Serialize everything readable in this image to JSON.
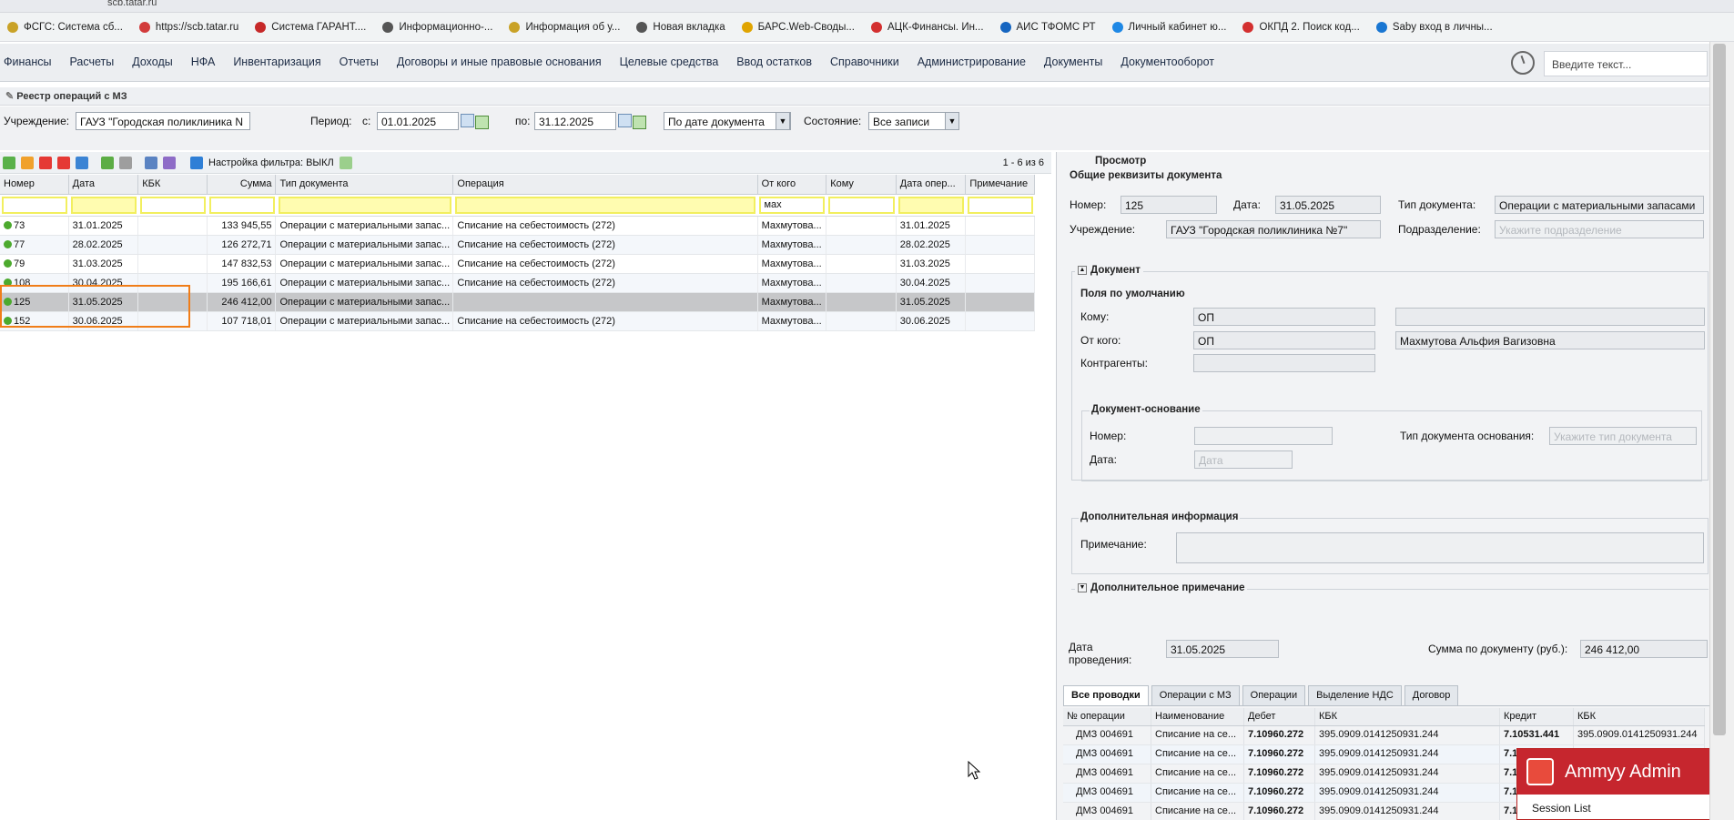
{
  "browser": {
    "url": "scb.tatar.ru",
    "bookmarks": [
      {
        "label": "ФСГС: Система сб...",
        "icon": "fsgs-icon",
        "color": "#c9a227"
      },
      {
        "label": "https://scb.tatar.ru",
        "icon": "cloud-icon",
        "color": "#d23b3b"
      },
      {
        "label": "Система ГАРАНТ....",
        "icon": "garant-icon",
        "color": "#c62828"
      },
      {
        "label": "Информационно-...",
        "icon": "globe-icon",
        "color": "#555555"
      },
      {
        "label": "Информация об у...",
        "icon": "emblem-icon",
        "color": "#c9a227"
      },
      {
        "label": "Новая вкладка",
        "icon": "globe-icon",
        "color": "#555555"
      },
      {
        "label": "БАРС.Web-Своды...",
        "icon": "bars-icon",
        "color": "#e0a400"
      },
      {
        "label": "АЦК-Финансы. Ин...",
        "icon": "ack-icon",
        "color": "#d32f2f"
      },
      {
        "label": "АИС ТФОМС РТ",
        "icon": "tfoms-icon",
        "color": "#1565c0"
      },
      {
        "label": "Личный кабинет ю...",
        "icon": "cabinet-icon",
        "color": "#1e88e5"
      },
      {
        "label": "ОКПД 2. Поиск код...",
        "icon": "okpd-icon",
        "color": "#d32f2f"
      },
      {
        "label": "Saby вход в личны...",
        "icon": "saby-icon",
        "color": "#1976d2"
      }
    ]
  },
  "menu": {
    "items": [
      "Финансы",
      "Расчеты",
      "Доходы",
      "НФА",
      "Инвентаризация",
      "Отчеты",
      "Договоры и иные правовые основания",
      "Целевые средства",
      "Ввод остатков",
      "Справочники",
      "Администрирование",
      "Документы",
      "Документооборот"
    ],
    "search_placeholder": "Введите текст..."
  },
  "page": {
    "title": "Реестр операций с МЗ"
  },
  "filters": {
    "institution_label": "Учреждение:",
    "institution_value": "ГАУЗ \"Городская поликлиника N",
    "period_label": "Период:",
    "from_label": "с:",
    "from_value": "01.01.2025",
    "to_label": "по:",
    "to_value": "31.12.2025",
    "date_mode_value": "По дате документа",
    "state_label": "Состояние:",
    "state_value": "Все записи"
  },
  "toolbar": {
    "filter_setting": "Настройка фильтра: ВЫКЛ",
    "pager": "1 - 6 из 6"
  },
  "grid": {
    "columns": [
      "Номер",
      "Дата",
      "КБК",
      "Сумма",
      "Тип документа",
      "Операция",
      "От кого",
      "Кому",
      "Дата опер...",
      "Примечание"
    ],
    "filter_from_whom": "мах",
    "rows": [
      {
        "num": "73",
        "date": "31.01.2025",
        "kbk": "",
        "sum": "133 945,55",
        "type": "Операции с материальными запас...",
        "op": "Списание на себестоимость (272)",
        "from": "Махмутова...",
        "to": "",
        "op_date": "31.01.2025",
        "note": ""
      },
      {
        "num": "77",
        "date": "28.02.2025",
        "kbk": "",
        "sum": "126 272,71",
        "type": "Операции с материальными запас...",
        "op": "Списание на себестоимость (272)",
        "from": "Махмутова...",
        "to": "",
        "op_date": "28.02.2025",
        "note": ""
      },
      {
        "num": "79",
        "date": "31.03.2025",
        "kbk": "",
        "sum": "147 832,53",
        "type": "Операции с материальными запас...",
        "op": "Списание на себестоимость (272)",
        "from": "Махмутова...",
        "to": "",
        "op_date": "31.03.2025",
        "note": ""
      },
      {
        "num": "108",
        "date": "30.04.2025",
        "kbk": "",
        "sum": "195 166,61",
        "type": "Операции с материальными запас...",
        "op": "Списание на себестоимость (272)",
        "from": "Махмутова...",
        "to": "",
        "op_date": "30.04.2025",
        "note": ""
      },
      {
        "num": "125",
        "date": "31.05.2025",
        "kbk": "",
        "sum": "246 412,00",
        "type": "Операции с материальными запас...",
        "op": "",
        "from": "Махмутова...",
        "to": "",
        "op_date": "31.05.2025",
        "note": ""
      },
      {
        "num": "152",
        "date": "30.06.2025",
        "kbk": "",
        "sum": "107 718,01",
        "type": "Операции с материальными запас...",
        "op": "Списание на себестоимость (272)",
        "from": "Махмутова...",
        "to": "",
        "op_date": "30.06.2025",
        "note": ""
      }
    ]
  },
  "preview": {
    "title": "Просмотр",
    "common_section": "Общие реквизиты документа",
    "number_label": "Номер:",
    "number_value": "125",
    "date_label": "Дата:",
    "date_value": "31.05.2025",
    "doctype_label": "Тип документа:",
    "doctype_value": "Операции с материальными запасами",
    "institution_label": "Учреждение:",
    "institution_value": "ГАУЗ \"Городская поликлиника №7\"",
    "division_label": "Подразделение:",
    "division_placeholder": "Укажите подразделение",
    "document_section": "Документ",
    "defaults_section": "Поля по умолчанию",
    "to_label": "Кому:",
    "to_value": "ОП",
    "from_label": "От кого:",
    "from_value": "ОП",
    "from_person": "Махмутова Альфия Вагизовна",
    "counterparties_label": "Контрагенты:",
    "basis_section": "Документ-основание",
    "basis_number_label": "Номер:",
    "basis_type_label": "Тип документа основания:",
    "basis_type_placeholder": "Укажите тип документа",
    "basis_date_label": "Дата:",
    "basis_date_placeholder": "Дата",
    "extra_section": "Дополнительная информация",
    "note_label": "Примечание:",
    "extra_note_section": "Дополнительное примечание",
    "post_date_label_1": "Дата",
    "post_date_label_2": "проведения:",
    "post_date_value": "31.05.2025",
    "doc_sum_label": "Сумма по документу (руб.):",
    "doc_sum_value": "246 412,00",
    "tabs": [
      "Все проводки",
      "Операции с МЗ",
      "Операции",
      "Выделение НДС",
      "Договор"
    ],
    "entries_columns": [
      "№ операции",
      "Наименование",
      "Дебет",
      "КБК",
      "Кредит",
      "КБК"
    ],
    "entries": [
      {
        "op": "ДМЗ 004691",
        "name": "Списание на се...",
        "debit": "7.10960.272",
        "kbk": "395.0909.0141250931.244",
        "credit": "7.10531.441",
        "kbk2": "395.0909.0141250931.244"
      },
      {
        "op": "ДМЗ 004691",
        "name": "Списание на се...",
        "debit": "7.10960.272",
        "kbk": "395.0909.0141250931.244",
        "credit": "7.1",
        "kbk2": ""
      },
      {
        "op": "ДМЗ 004691",
        "name": "Списание на се...",
        "debit": "7.10960.272",
        "kbk": "395.0909.0141250931.244",
        "credit": "7.1",
        "kbk2": ""
      },
      {
        "op": "ДМЗ 004691",
        "name": "Списание на се...",
        "debit": "7.10960.272",
        "kbk": "395.0909.0141250931.244",
        "credit": "7.1",
        "kbk2": ""
      },
      {
        "op": "ДМЗ 004691",
        "name": "Списание на се...",
        "debit": "7.10960.272",
        "kbk": "395.0909.0141250931.244",
        "credit": "7.1",
        "kbk2": ""
      }
    ]
  },
  "ammyy": {
    "title": "Ammyy Admin",
    "menu_item": "Session List"
  }
}
